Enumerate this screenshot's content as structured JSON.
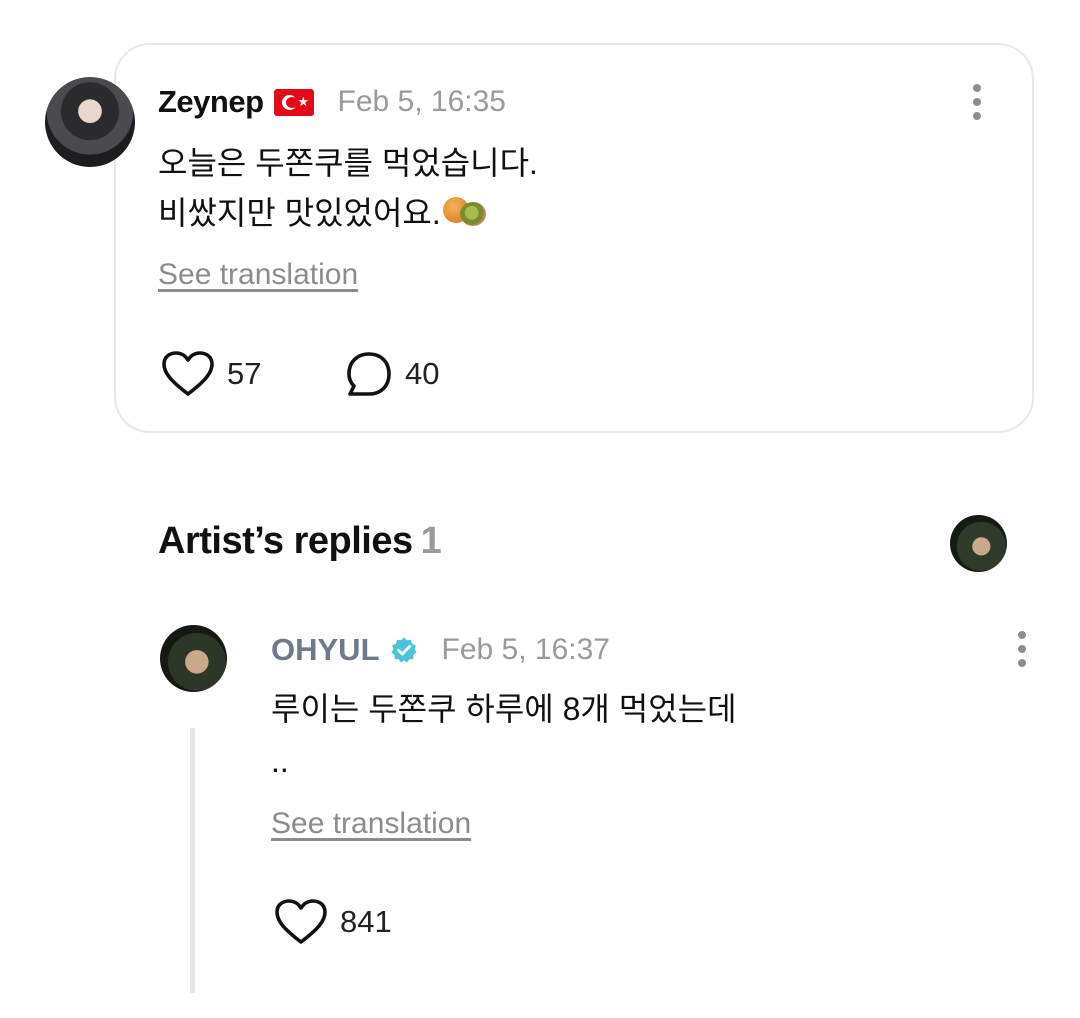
{
  "post": {
    "author": "Zeynep",
    "flag_icon": "turkey-flag-icon",
    "timestamp": "Feb 5, 16:35",
    "text_line1": "오늘은 두쫀쿠를 먹었습니다.",
    "text_line2": "비쌌지만 맛있었어요.",
    "emoji": "buns-emoji",
    "see_translation": "See translation",
    "likes": "57",
    "comments": "40"
  },
  "replies_section": {
    "title": "Artist’s replies",
    "count": "1"
  },
  "reply": {
    "author": "OHYUL",
    "verified_icon": "verified-badge-icon",
    "timestamp": "Feb 5, 16:37",
    "text": "루이는 두쫀쿠 하루에 8개 먹었는데\n..",
    "see_translation": "See translation",
    "likes": "841"
  },
  "colors": {
    "verified": "#4cc3d9",
    "muted_text": "#9a9a9a",
    "artist_name": "#6e7a87",
    "card_border": "#e8e8e8"
  }
}
